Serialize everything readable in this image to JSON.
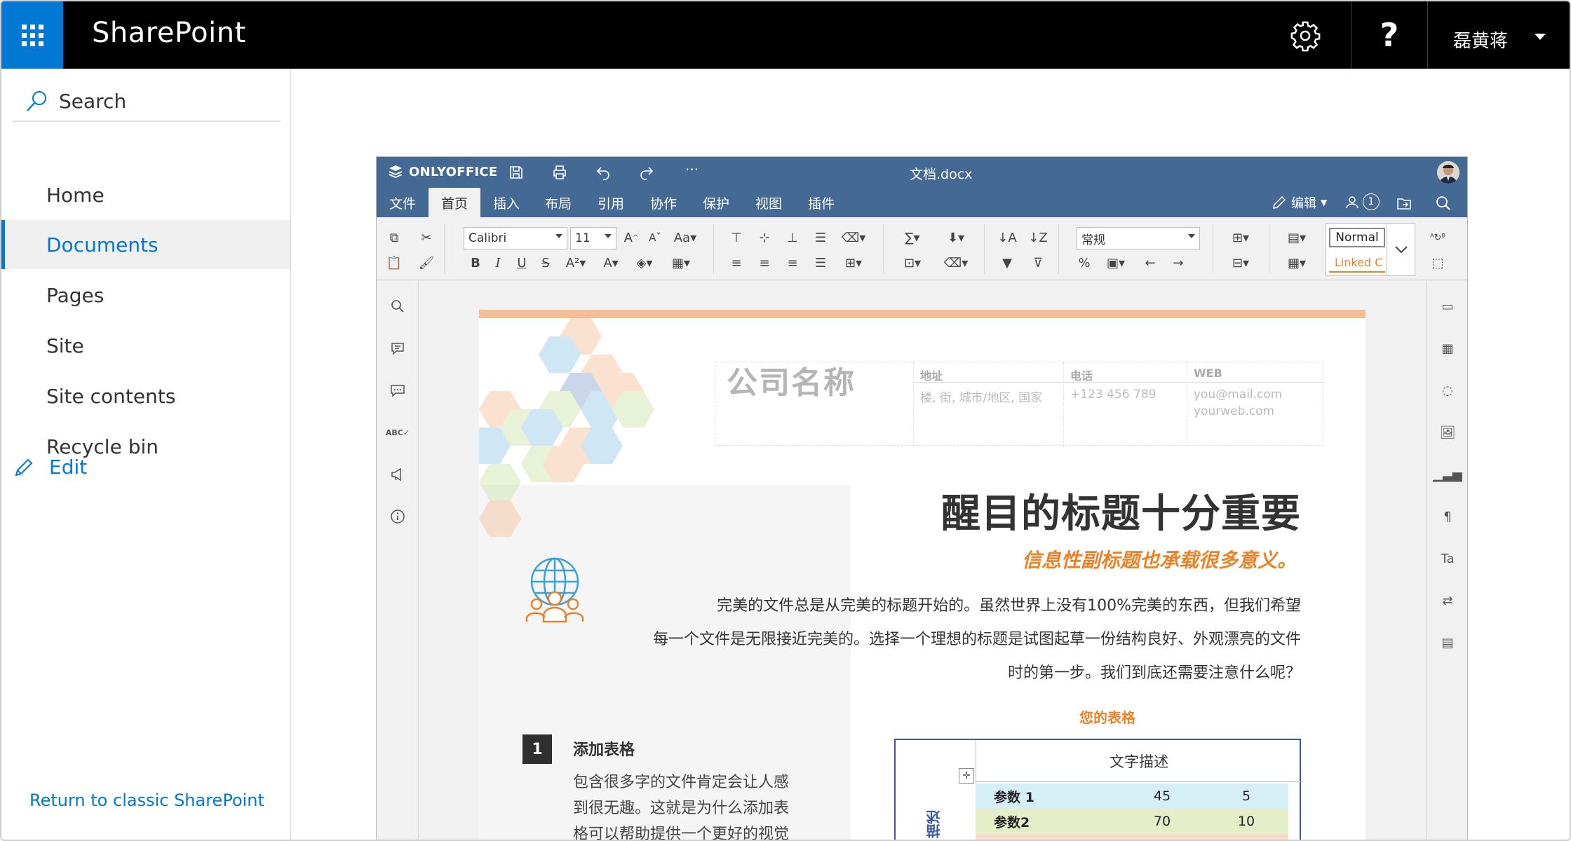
{
  "topbar": {
    "brand": "SharePoint",
    "help": "?",
    "user": "磊黄蒋"
  },
  "leftnav": {
    "search": "Search",
    "items": [
      {
        "label": "Home"
      },
      {
        "label": "Documents",
        "active": true
      },
      {
        "label": "Pages"
      },
      {
        "label": "Site"
      },
      {
        "label": "Site contents"
      },
      {
        "label": "Recycle bin"
      }
    ],
    "edit": "Edit",
    "return": "Return to classic SharePoint"
  },
  "editor": {
    "logo": "ONLYOFFICE",
    "more": "···",
    "docname": "文档.docx",
    "tabs": [
      "文件",
      "首页",
      "插入",
      "布局",
      "引用",
      "协作",
      "保护",
      "视图",
      "插件"
    ],
    "edit_mode": "编辑",
    "users_count": "1",
    "toolbar": {
      "font": "Calibri",
      "size": "11",
      "paragraph_style": "常规",
      "style_normal": "Normal",
      "style_linked": "Linked C"
    }
  },
  "document": {
    "company": "公司名称",
    "header": {
      "address_label": "地址",
      "address_value": "楼, 街, 城市/地区, 国家",
      "phone_label": "电话",
      "phone_value": "+123 456 789",
      "web_label": "WEB",
      "web_value1": "you@mail.com",
      "web_value2": "yourweb.com"
    },
    "title": "醒目的标题十分重要",
    "subtitle": "信息性副标题也承载很多意义。",
    "body": [
      "完美的文件总是从完美的标题开始的。虽然世界上没有100%完美的东西，但我们希望",
      "每一个文件是无限接近完美的。选择一个理想的标题是试图起草一份结构良好、外观漂亮的文件",
      "时的第一步。我们到底还需要注意什么呢？"
    ],
    "table_caption": "您的表格",
    "table": {
      "header": "文字描述",
      "side_label": "描述",
      "rows": [
        {
          "name": "参数 1",
          "a": "45",
          "b": "5"
        },
        {
          "name": "参数2",
          "a": "70",
          "b": "10"
        }
      ]
    },
    "section": {
      "number": "1",
      "title": "添加表格",
      "lines": [
        "包含很多字的文件肯定会让人感",
        "到很无趣。这就是为什么添加表",
        "格可以帮助提供一个更好的视觉"
      ]
    }
  },
  "colors": {
    "sharepoint_blue": "#0078d4",
    "onlyoffice_header": "#446995",
    "accent_orange": "#e8832a"
  }
}
